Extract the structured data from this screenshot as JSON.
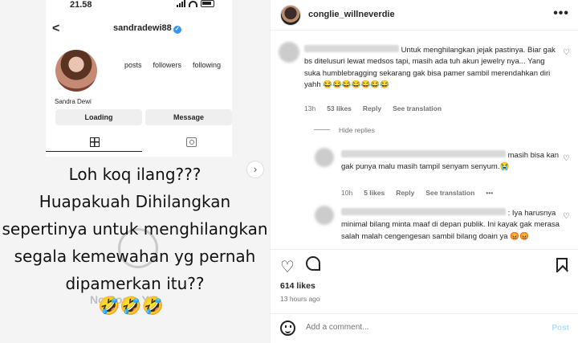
{
  "phone": {
    "time": "21.58",
    "username": "sandradewi88",
    "stats": [
      "posts",
      "followers",
      "following"
    ],
    "display_name": "Sandra Dewi",
    "buttons": {
      "loading": "Loading",
      "message": "Message"
    }
  },
  "overlay": {
    "lines": [
      "Loh koq ilang???",
      "Huapakuah Dihilangkan",
      "sepertinya untuk menghilangkan",
      "segala kemewahan yg pernah",
      "dipamerkan itu??"
    ],
    "emoji": "🤣🤣🤣",
    "faint_text": "No Posts Yet"
  },
  "post": {
    "author": "conglie_willneverdie",
    "comments": [
      {
        "text": "Untuk menghilangkan jejak pastinya. Biar gak bs ditelusuri lewat medsos tapi, masih ada tuh akun jewelry nya... Yang suka humblebragging sekarang gak bisa pamer sambil merendahkan diri yahh 😂😂😂😂😂😂😂",
        "time": "13h",
        "likes": "53 likes",
        "reply": "Reply",
        "translation": "See translation"
      }
    ],
    "hide_replies": "Hide replies",
    "replies": [
      {
        "text": "masih bisa kan gak punya malu masih tampil senyam senyum.😭",
        "time": "10h",
        "likes": "5 likes",
        "reply": "Reply",
        "translation": "See translation",
        "more": "•••"
      },
      {
        "text": ": Iya harusnya minimal bilang minta maaf di depan publik. Ini kayak gak merasa salah malah cengengesan sambil bilang doain ya 😡😡"
      }
    ],
    "likes": "614 likes",
    "time_ago": "13 hours ago",
    "add_comment_placeholder": "Add a comment...",
    "post_label": "Post",
    "more": "•••"
  }
}
